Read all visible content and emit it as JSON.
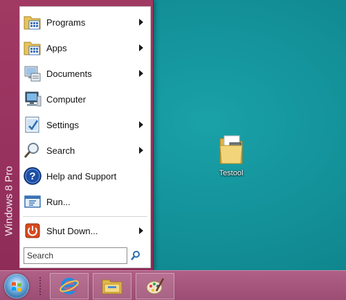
{
  "start_menu": {
    "brand": "Windows 8 Pro",
    "items": [
      {
        "label": "Programs",
        "icon": "programs-icon",
        "submenu": true
      },
      {
        "label": "Apps",
        "icon": "apps-icon",
        "submenu": true
      },
      {
        "label": "Documents",
        "icon": "documents-icon",
        "submenu": true
      },
      {
        "label": "Computer",
        "icon": "computer-icon",
        "submenu": false
      },
      {
        "label": "Settings",
        "icon": "settings-icon",
        "submenu": true
      },
      {
        "label": "Search",
        "icon": "search-icon",
        "submenu": true
      },
      {
        "label": "Help and Support",
        "icon": "help-icon",
        "submenu": false
      },
      {
        "label": "Run...",
        "icon": "run-icon",
        "submenu": false
      },
      {
        "label": "Shut Down...",
        "icon": "power-icon",
        "submenu": true
      }
    ],
    "search": {
      "placeholder": "Search"
    }
  },
  "desktop": {
    "icons": [
      {
        "label": "Testool",
        "icon": "folder-icon"
      }
    ]
  },
  "taskbar": {
    "pinned": [
      {
        "name": "internet-explorer",
        "icon": "internet-explorer-icon"
      },
      {
        "name": "file-explorer",
        "icon": "file-explorer-icon"
      },
      {
        "name": "paint",
        "icon": "paint-icon"
      }
    ]
  },
  "colors": {
    "desktop": "#128f96",
    "start_menu": "#9a3460",
    "taskbar": "#a8577e"
  }
}
